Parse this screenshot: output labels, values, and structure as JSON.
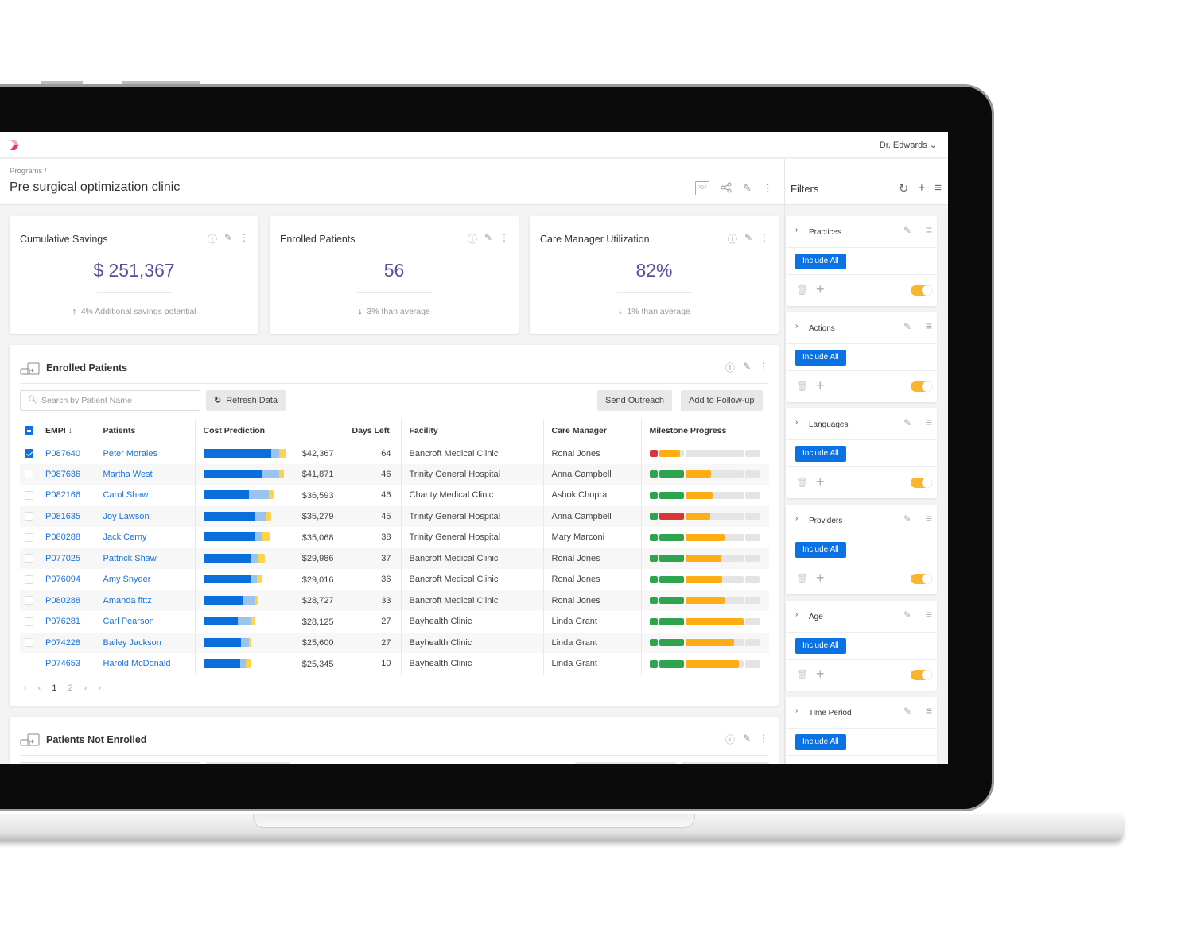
{
  "app": {
    "user_menu": "Dr. Edwards ⌄"
  },
  "header": {
    "breadcrumb": "Programs /",
    "title": "Pre surgical optimization clinic"
  },
  "kpis": [
    {
      "title": "Cumulative Savings",
      "value": "$ 251,367",
      "trend": "up",
      "trend_icon": "↑",
      "subtitle": "4% Additional savings potential"
    },
    {
      "title": "Enrolled Patients",
      "value": "56",
      "trend": "down",
      "trend_icon": "↓",
      "subtitle": "3% than average"
    },
    {
      "title": "Care Manager Utilization",
      "value": "82%",
      "trend": "down",
      "trend_icon": "↓",
      "subtitle": "1% than average"
    }
  ],
  "enrolled": {
    "title": "Enrolled Patients",
    "search_placeholder": "Search by Patient Name",
    "refresh_label": "Refresh Data",
    "send_outreach_label": "Send Outreach",
    "follow_up_label": "Add to Follow-up",
    "columns": [
      "EMPI ↓",
      "Patients",
      "Cost Prediction",
      "Days Left",
      "Facility",
      "Care Manager",
      "Milestone Progress"
    ],
    "colors": {
      "cost_primary": "#0a6fdc",
      "cost_secondary": "#9ac4f0",
      "cost_tertiary": "#ffd24d",
      "green": "#2ea44f",
      "red": "#dd3535",
      "orange": "#ffad14"
    },
    "rows": [
      {
        "checked": true,
        "empi": "P087640",
        "patient": "Peter Morales",
        "cost": "$42,367",
        "cost_parts": [
          0.81,
          0.1,
          0.09
        ],
        "cost_total": 1.0,
        "days": "64",
        "facility": "Bancroft Medical Clinic",
        "manager": "Ronal Jones",
        "milestones": [
          [
            "red",
            1
          ],
          [
            "orange",
            0.87
          ],
          [
            "gray",
            0
          ],
          [
            "gray",
            0
          ]
        ]
      },
      {
        "checked": false,
        "empi": "P087636",
        "patient": "Martha West",
        "cost": "$41,871",
        "cost_parts": [
          0.7,
          0.21,
          0.06
        ],
        "cost_total": 0.97,
        "days": "46",
        "facility": "Trinity General Hospital",
        "manager": "Anna Campbell",
        "milestones": [
          [
            "green",
            1
          ],
          [
            "green",
            1
          ],
          [
            "orange",
            0.44
          ],
          [
            "gray",
            0
          ]
        ]
      },
      {
        "checked": false,
        "empi": "P082166",
        "patient": "Carol Shaw",
        "cost": "$36,593",
        "cost_parts": [
          0.55,
          0.24,
          0.05
        ],
        "cost_total": 0.84,
        "days": "46",
        "facility": "Charity Medical Clinic",
        "manager": "Ashok Chopra",
        "milestones": [
          [
            "green",
            1
          ],
          [
            "green",
            1
          ],
          [
            "orange",
            0.47
          ],
          [
            "gray",
            0
          ]
        ]
      },
      {
        "checked": false,
        "empi": "P081635",
        "patient": "Joy Lawson",
        "cost": "$35,279",
        "cost_parts": [
          0.62,
          0.14,
          0.05
        ],
        "cost_total": 0.81,
        "days": "45",
        "facility": "Trinity General Hospital",
        "manager": "Anna Campbell",
        "milestones": [
          [
            "green",
            1
          ],
          [
            "red",
            1
          ],
          [
            "orange",
            0.43
          ],
          [
            "gray",
            0
          ]
        ]
      },
      {
        "checked": false,
        "empi": "P080288",
        "patient": "Jack Cerny",
        "cost": "$35,068",
        "cost_parts": [
          0.61,
          0.1,
          0.09
        ],
        "cost_total": 0.8,
        "days": "38",
        "facility": "Trinity General Hospital",
        "manager": "Mary Marconi",
        "milestones": [
          [
            "green",
            1
          ],
          [
            "green",
            1
          ],
          [
            "orange",
            0.68
          ],
          [
            "gray",
            0
          ]
        ]
      },
      {
        "checked": false,
        "empi": "P077025",
        "patient": "Pattrick Shaw",
        "cost": "$29,986",
        "cost_parts": [
          0.57,
          0.09,
          0.08
        ],
        "cost_total": 0.74,
        "days": "37",
        "facility": "Bancroft Medical Clinic",
        "manager": "Ronal Jones",
        "milestones": [
          [
            "green",
            1
          ],
          [
            "green",
            1
          ],
          [
            "orange",
            0.63
          ],
          [
            "gray",
            0
          ]
        ]
      },
      {
        "checked": false,
        "empi": "P076094",
        "patient": "Amy Snyder",
        "cost": "$29,016",
        "cost_parts": [
          0.58,
          0.06,
          0.06
        ],
        "cost_total": 0.7,
        "days": "36",
        "facility": "Bancroft Medical Clinic",
        "manager": "Ronal Jones",
        "milestones": [
          [
            "green",
            1
          ],
          [
            "green",
            1
          ],
          [
            "orange",
            0.64
          ],
          [
            "gray",
            0
          ]
        ]
      },
      {
        "checked": false,
        "empi": "P080288",
        "patient": "Amanda fittz",
        "cost": "$28,727",
        "cost_parts": [
          0.48,
          0.13,
          0.04
        ],
        "cost_total": 0.65,
        "days": "33",
        "facility": "Bancroft Medical Clinic",
        "manager": "Ronal Jones",
        "milestones": [
          [
            "green",
            1
          ],
          [
            "green",
            1
          ],
          [
            "orange",
            0.68
          ],
          [
            "gray",
            0
          ]
        ]
      },
      {
        "checked": false,
        "empi": "P076281",
        "patient": "Carl Pearson",
        "cost": "$28,125",
        "cost_parts": [
          0.41,
          0.17,
          0.04
        ],
        "cost_total": 0.62,
        "days": "27",
        "facility": "Bayhealth Clinic",
        "manager": "Linda Grant",
        "milestones": [
          [
            "green",
            1
          ],
          [
            "green",
            1
          ],
          [
            "orange",
            1
          ],
          [
            "gray",
            0
          ]
        ]
      },
      {
        "checked": false,
        "empi": "P074228",
        "patient": "Bailey Jackson",
        "cost": "$25,600",
        "cost_parts": [
          0.45,
          0.1,
          0.03
        ],
        "cost_total": 0.58,
        "days": "27",
        "facility": "Bayhealth Clinic",
        "manager": "Linda Grant",
        "milestones": [
          [
            "green",
            1
          ],
          [
            "green",
            1
          ],
          [
            "orange",
            0.84
          ],
          [
            "gray",
            0
          ]
        ]
      },
      {
        "checked": false,
        "empi": "P074653",
        "patient": "Harold McDonald",
        "cost": "$25,345",
        "cost_parts": [
          0.44,
          0.07,
          0.06
        ],
        "cost_total": 0.57,
        "days": "10",
        "facility": "Bayhealth Clinic",
        "manager": "Linda Grant",
        "milestones": [
          [
            "green",
            1
          ],
          [
            "green",
            1
          ],
          [
            "orange",
            0.92
          ],
          [
            "gray",
            0
          ]
        ]
      }
    ],
    "pagination": {
      "first": "‹",
      "prev": "‹",
      "pages": [
        "1",
        "2"
      ],
      "current": "1",
      "next": "›",
      "last": "›"
    }
  },
  "not_enrolled": {
    "title": "Patients Not Enrolled"
  },
  "filters": {
    "title": "Filters",
    "items": [
      {
        "name": "Practices",
        "include_label": "Include All",
        "enabled": true
      },
      {
        "name": "Actions",
        "include_label": "Include All",
        "enabled": true
      },
      {
        "name": "Languages",
        "include_label": "Include All",
        "enabled": true
      },
      {
        "name": "Providers",
        "include_label": "Include All",
        "enabled": true
      },
      {
        "name": "Age",
        "include_label": "Include All",
        "enabled": true
      },
      {
        "name": "Time Period",
        "include_label": "Include All",
        "enabled": true
      }
    ]
  }
}
